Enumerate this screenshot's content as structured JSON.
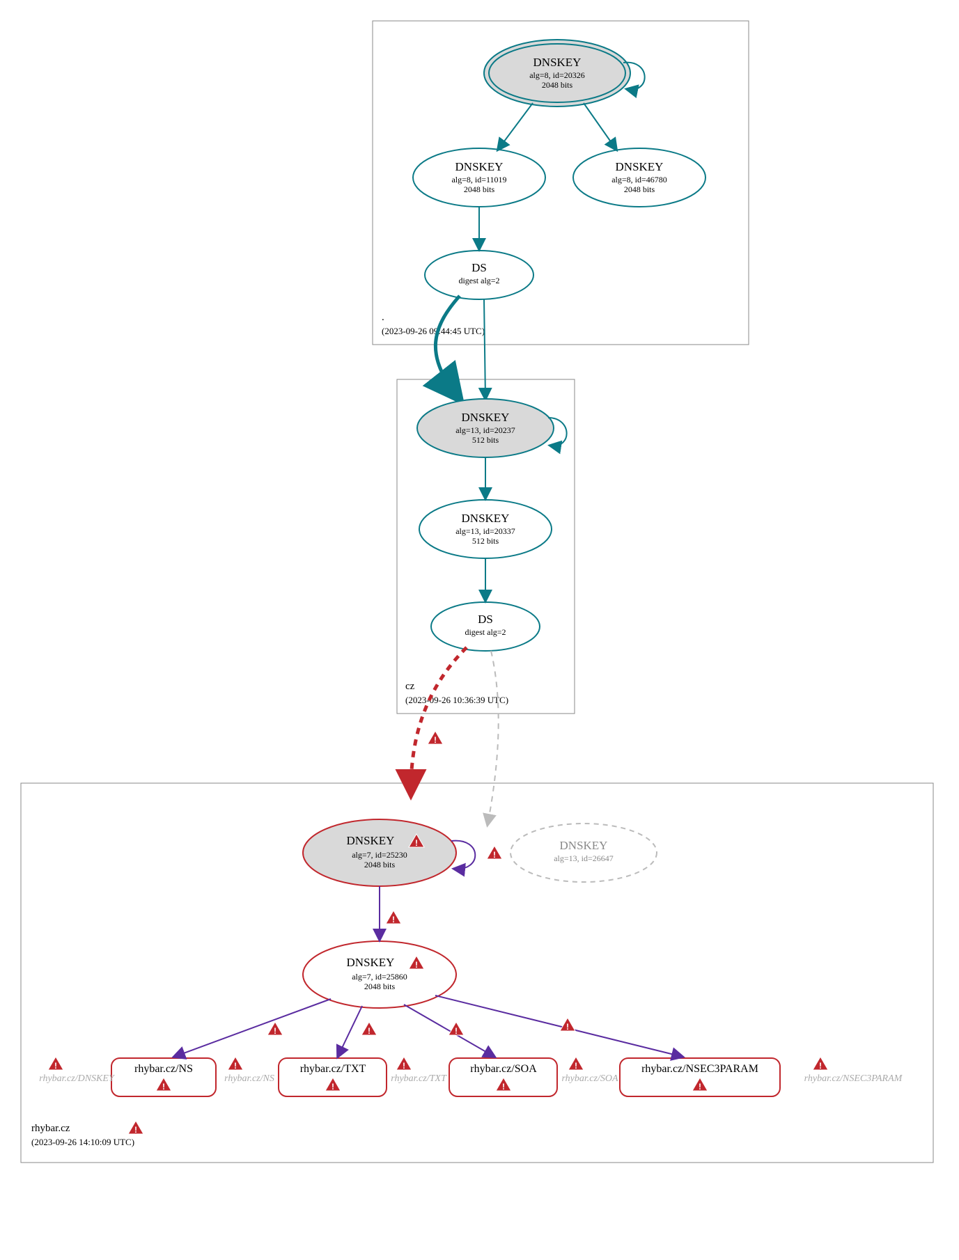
{
  "zones": {
    "root": {
      "name": ".",
      "timestamp": "(2023-09-26 09:44:45 UTC)"
    },
    "cz": {
      "name": "cz",
      "timestamp": "(2023-09-26 10:36:39 UTC)"
    },
    "rhybar": {
      "name": "rhybar.cz",
      "timestamp": "(2023-09-26 14:10:09 UTC)"
    }
  },
  "nodes": {
    "root_ksk": {
      "title": "DNSKEY",
      "l2": "alg=8, id=20326",
      "l3": "2048 bits"
    },
    "root_zsk1": {
      "title": "DNSKEY",
      "l2": "alg=8, id=11019",
      "l3": "2048 bits"
    },
    "root_zsk2": {
      "title": "DNSKEY",
      "l2": "alg=8, id=46780",
      "l3": "2048 bits"
    },
    "root_ds": {
      "title": "DS",
      "l2": "digest alg=2"
    },
    "cz_ksk": {
      "title": "DNSKEY",
      "l2": "alg=13, id=20237",
      "l3": "512 bits"
    },
    "cz_zsk": {
      "title": "DNSKEY",
      "l2": "alg=13, id=20337",
      "l3": "512 bits"
    },
    "cz_ds": {
      "title": "DS",
      "l2": "digest alg=2"
    },
    "rh_ksk": {
      "title": "DNSKEY",
      "l2": "alg=7, id=25230",
      "l3": "2048 bits"
    },
    "rh_zsk": {
      "title": "DNSKEY",
      "l2": "alg=7, id=25860",
      "l3": "2048 bits"
    },
    "rh_miss": {
      "title": "DNSKEY",
      "l2": "alg=13, id=26647"
    }
  },
  "rrsets": {
    "ns": "rhybar.cz/NS",
    "txt": "rhybar.cz/TXT",
    "soa": "rhybar.cz/SOA",
    "n3p": "rhybar.cz/NSEC3PARAM"
  },
  "neg": {
    "dnskey": "rhybar.cz/DNSKEY",
    "ns": "rhybar.cz/NS",
    "txt": "rhybar.cz/TXT",
    "soa": "rhybar.cz/SOA",
    "n3p": "rhybar.cz/NSEC3PARAM"
  }
}
